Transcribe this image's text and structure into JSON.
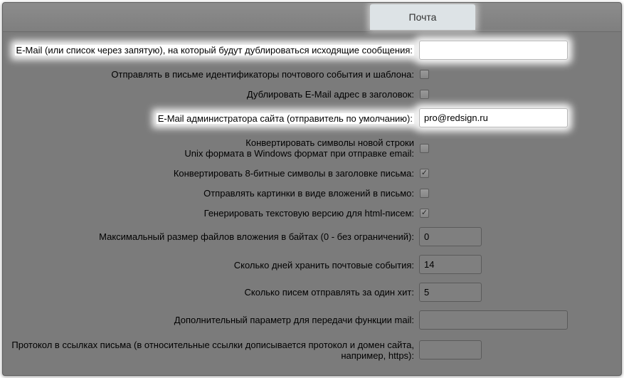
{
  "tab": {
    "label": "Почта"
  },
  "settings": {
    "dup_email": {
      "label": "E-Mail (или список через запятую), на который будут дублироваться исходящие сообщения:",
      "value": ""
    },
    "send_ids": {
      "label": "Отправлять в письме идентификаторы почтового события и шаблона:",
      "checked": false
    },
    "dup_header": {
      "label": "Дублировать E-Mail адрес в заголовок:",
      "checked": false
    },
    "admin_email": {
      "label": "E-Mail администратора сайта (отправитель по умолчанию):",
      "value": "pro@redsign.ru"
    },
    "convert_newlines": {
      "line1": "Конвертировать символы новой строки",
      "line2": "Unix формата в Windows формат при отправке email:",
      "checked": false
    },
    "convert_8bit": {
      "label": "Конвертировать 8-битные символы в заголовке письма:",
      "checked": true
    },
    "attach_images": {
      "label": "Отправлять картинки в виде вложений в письмо:",
      "checked": false
    },
    "gen_text": {
      "label": "Генерировать текстовую версию для html-писем:",
      "checked": true
    },
    "max_attach": {
      "label": "Максимальный размер файлов вложения в байтах (0 - без ограничений):",
      "value": "0"
    },
    "keep_days": {
      "label": "Сколько дней хранить почтовые события:",
      "value": "14"
    },
    "per_hit": {
      "label": "Сколько писем отправлять за один хит:",
      "value": "5"
    },
    "mail_param": {
      "label": "Дополнительный параметр для передачи функции mail:",
      "value": ""
    },
    "protocol": {
      "line1": "Протокол в ссылках письма (в относительные ссылки дописывается протокол и домен сайта,",
      "line2": "например, https):",
      "value": ""
    }
  },
  "check_mark": "✓"
}
